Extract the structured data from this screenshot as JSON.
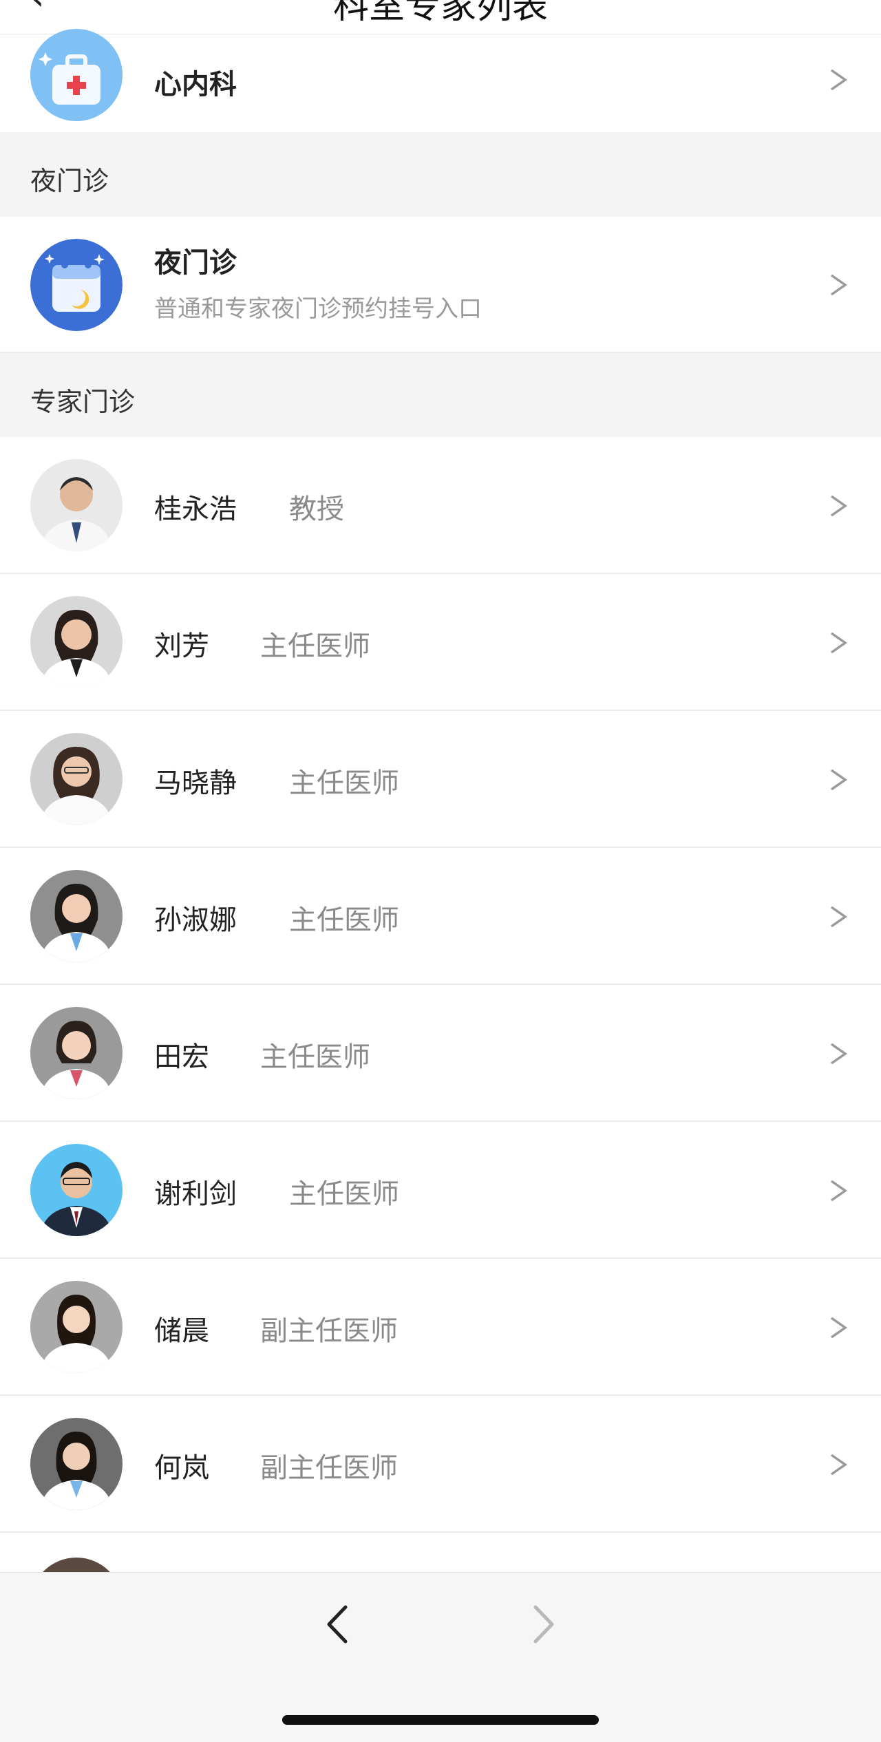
{
  "header": {
    "title": "科室专家列表"
  },
  "department": {
    "name": "心内科"
  },
  "sections": {
    "night": "夜门诊",
    "experts": "专家门诊"
  },
  "night_clinic": {
    "name": "夜门诊",
    "description": "普通和专家夜门诊预约挂号入口"
  },
  "doctors": [
    {
      "name": "桂永浩",
      "title": "教授"
    },
    {
      "name": "刘芳",
      "title": "主任医师"
    },
    {
      "name": "马晓静",
      "title": "主任医师"
    },
    {
      "name": "孙淑娜",
      "title": "主任医师"
    },
    {
      "name": "田宏",
      "title": "主任医师"
    },
    {
      "name": "谢利剑",
      "title": "主任医师"
    },
    {
      "name": "储晨",
      "title": "副主任医师"
    },
    {
      "name": "何岚",
      "title": "副主任医师"
    }
  ],
  "icons": {
    "chevron": "chevron-right-icon",
    "back": "back-arrow-icon",
    "forward": "forward-arrow-icon",
    "department": "medical-kit-icon",
    "night": "night-calendar-icon"
  },
  "colors": {
    "accent_blue": "#5aa7f2",
    "night_blue": "#3b6fd6",
    "section_bg": "#f4f4f4",
    "muted_text": "#8a8a8a"
  }
}
